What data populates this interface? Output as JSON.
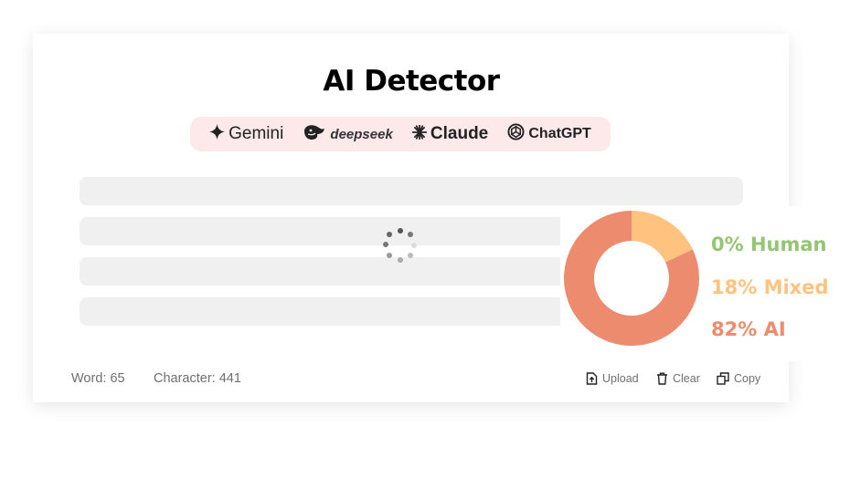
{
  "header": {
    "title": "AI Detector"
  },
  "models": [
    {
      "label": "Gemini",
      "icon": "sparkle-icon"
    },
    {
      "label": "deepseek",
      "icon": "whale-icon"
    },
    {
      "label": "Claude",
      "icon": "asterisk-icon"
    },
    {
      "label": "ChatGPT",
      "icon": "openai-icon"
    }
  ],
  "footer": {
    "word_count": "Word: 65",
    "char_count": "Character: 441",
    "upload_label": "Upload",
    "clear_label": "Clear",
    "copy_label": "Copy"
  },
  "result": {
    "human": {
      "label": "0% Human",
      "percent": 0,
      "color": "#93c572"
    },
    "mixed": {
      "label": "18% Mixed",
      "percent": 18,
      "color": "#ffc37f"
    },
    "ai": {
      "label": "82% AI",
      "percent": 82,
      "color": "#ec8b6d"
    }
  }
}
